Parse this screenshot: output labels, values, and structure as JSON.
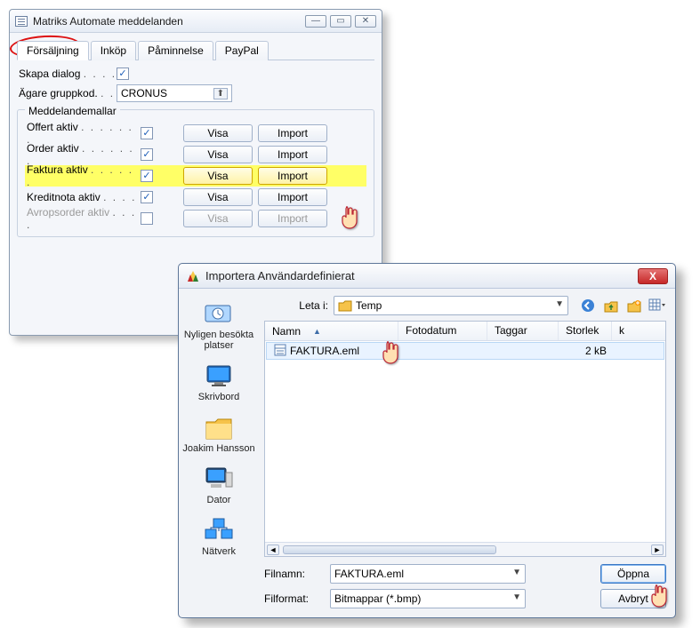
{
  "win1": {
    "title": "Matriks Automate meddelanden",
    "tabs": [
      "Försäljning",
      "Inköp",
      "Påminnelse",
      "PayPal"
    ],
    "active_tab": 0,
    "skapa_dialog_label": "Skapa dialog",
    "skapa_dialog_checked": true,
    "agare_label": "Ägare gruppkod.",
    "agare_value": "CRONUS",
    "fieldset_title": "Meddelandemallar",
    "btn_visa": "Visa",
    "btn_import": "Import",
    "rows": [
      {
        "label": "Offert aktiv",
        "checked": true,
        "highlighted": false,
        "disabled": false
      },
      {
        "label": "Order aktiv",
        "checked": true,
        "highlighted": false,
        "disabled": false
      },
      {
        "label": "Faktura aktiv",
        "checked": true,
        "highlighted": true,
        "disabled": false
      },
      {
        "label": "Kreditnota aktiv",
        "checked": true,
        "highlighted": false,
        "disabled": false
      },
      {
        "label": "Avropsorder aktiv",
        "checked": false,
        "highlighted": false,
        "disabled": true
      }
    ]
  },
  "win2": {
    "title": "Importera Användardefinierat",
    "lookin_label": "Leta i:",
    "lookin_value": "Temp",
    "columns": {
      "name": "Namn",
      "foto": "Fotodatum",
      "tag": "Taggar",
      "size": "Storlek"
    },
    "file": {
      "name": "FAKTURA.eml",
      "size": "2 kB"
    },
    "filnamn_label": "Filnamn:",
    "filnamn_value": "FAKTURA.eml",
    "filformat_label": "Filformat:",
    "filformat_value": "Bitmappar (*.bmp)",
    "btn_open": "Öppna",
    "btn_cancel": "Avbryt",
    "places": {
      "recent": "Nyligen besökta platser",
      "desktop": "Skrivbord",
      "user": "Joakim Hansson",
      "computer": "Dator",
      "network": "Nätverk"
    }
  }
}
